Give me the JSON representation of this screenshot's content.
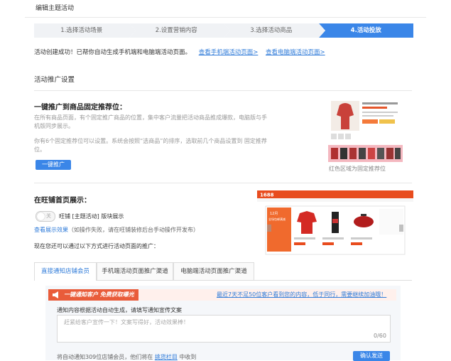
{
  "page_title": "编辑主题活动",
  "steps": [
    "1.选择活动场景",
    "2.设置营销内容",
    "3.选择活动商品",
    "4.活动投放"
  ],
  "active_step": 3,
  "success": {
    "text": "活动创建成功！已帮你自动生成手机端和电脑端活动页面。",
    "mobile_link": "查看手机端活动页面>",
    "pc_link": "查看电脑端活动页面>"
  },
  "section_title": "活动推广设置",
  "fixed": {
    "heading": "一键推广到商品固定推荐位：",
    "desc1": "在所有商品页面，有个固定推广商品的位置，集中客户流量把活动商品推成爆款，电脑版与手机版同步展示。",
    "desc2": "你有6个固定推荐位可以设置。系统会按照“选商品”的排序，选取前几个商品设置到 固定推荐位。",
    "button": "一键推广",
    "caption": "红色区域为固定推荐位"
  },
  "wangpu": {
    "heading": "在旺铺首页展示：",
    "toggle_text": "关",
    "toggle_label": "旺铺 [主题活动] 版块展示",
    "view_link": "查看展示效果",
    "view_note": "（如操作失败，请在旺铺装修后台手动操作开发布）",
    "promo_text": "现在您还可以通过以下方式进行活动页面的推广：",
    "preview_brand": "1688",
    "preview_tag": "12月\n全场包邮满减"
  },
  "tabs": [
    "直接通知店铺会员",
    "手机端活动页面推广渠道",
    "电脑端活动页面推广渠道"
  ],
  "active_tab": 0,
  "notify": {
    "banner_left": "一键通知客户 免费获取曝光",
    "banner_right": "最近7天不足50位客户看到您的内容，低于同行，需要继续加油哦！",
    "label": "通知内容根据活动自动生成，请填写通知宣传文案",
    "placeholder": "赶紧给客户宣传一下！文案写得好，活动效果棒！",
    "counter": "0/60",
    "bottom_prefix": "将自动通知309位店铺会员，他们将在",
    "bottom_link": "挑货栏目",
    "bottom_suffix": "中收到",
    "confirm": "确认发送"
  },
  "colors": {
    "accent": "#3a86e8",
    "link": "#2f7bd9",
    "orange": "#e95c3a",
    "red_zone": "#f4b8c0"
  }
}
